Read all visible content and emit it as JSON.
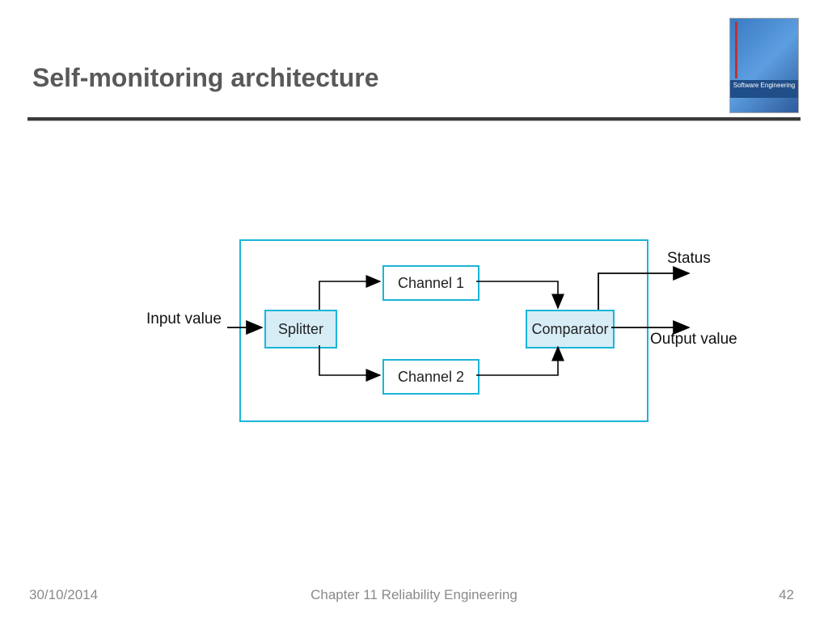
{
  "slide": {
    "title": "Self-monitoring architecture",
    "book_label": "Software Engineering",
    "footer_date": "30/10/2014",
    "footer_chapter": "Chapter 11 Reliability Engineering",
    "footer_page": "42"
  },
  "diagram": {
    "nodes": {
      "splitter": "Splitter",
      "channel1": "Channel 1",
      "channel2": "Channel 2",
      "comparator": "Comparator"
    },
    "labels": {
      "input": "Input value",
      "status": "Status",
      "output": "Output value"
    },
    "edges": [
      "input → splitter",
      "splitter → channel1",
      "splitter → channel2",
      "channel1 → comparator",
      "channel2 → comparator",
      "comparator → status",
      "comparator → output"
    ],
    "colors": {
      "border": "#1ab5d8",
      "fill": "#d6edf6",
      "arrow": "#000000"
    }
  }
}
